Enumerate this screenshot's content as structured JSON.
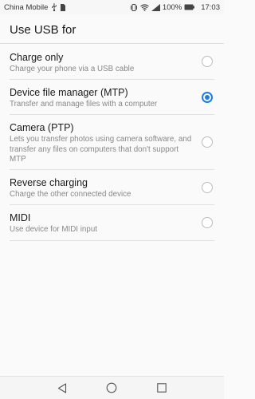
{
  "status_bar": {
    "carrier": "China Mobile",
    "battery_percent": "100%",
    "time": "17:03",
    "icons": [
      "usb-icon",
      "sim-icon",
      "vibrate-icon",
      "wifi-icon",
      "signal-icon",
      "battery-icon"
    ]
  },
  "header": {
    "title": "Use USB for"
  },
  "options": [
    {
      "title": "Charge only",
      "subtitle": "Charge your phone via a USB cable",
      "selected": false
    },
    {
      "title": "Device file manager (MTP)",
      "subtitle": "Transfer and manage files with a computer",
      "selected": true
    },
    {
      "title": "Camera (PTP)",
      "subtitle": "Lets you transfer photos using camera software, and transfer any files on computers that don't support MTP",
      "selected": false
    },
    {
      "title": "Reverse charging",
      "subtitle": "Charge the other connected device",
      "selected": false
    },
    {
      "title": "MIDI",
      "subtitle": "Use device for MIDI input",
      "selected": false
    }
  ],
  "nav_bar": {
    "icons": [
      "back-icon",
      "home-icon",
      "recents-icon"
    ]
  },
  "colors": {
    "accent": "#1e7be6",
    "background": "#fafafa"
  }
}
